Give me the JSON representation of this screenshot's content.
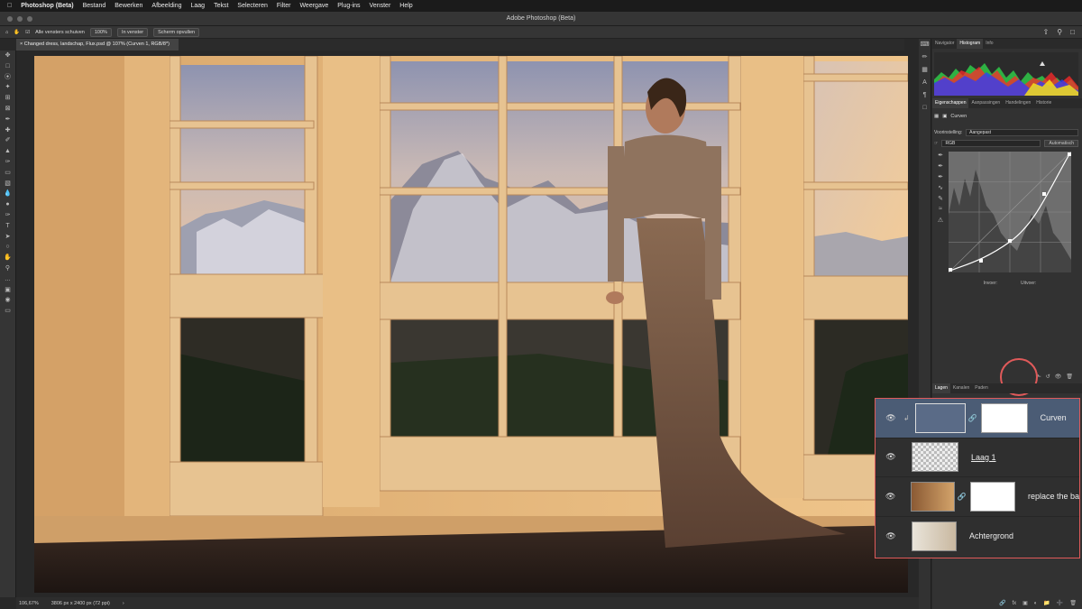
{
  "menubar": {
    "apple": "",
    "app": "Photoshop (Beta)",
    "items": [
      "Bestand",
      "Bewerken",
      "Afbeelding",
      "Laag",
      "Tekst",
      "Selecteren",
      "Filter",
      "Weergave",
      "Plug-ins",
      "Venster",
      "Help"
    ]
  },
  "window": {
    "title": "Adobe Photoshop (Beta)"
  },
  "options": {
    "scroll_all": "Alle vensters schuiven",
    "zoom_100": "100%",
    "fit_screen": "In venster",
    "fill_screen": "Scherm opvullen"
  },
  "document": {
    "tab": "Changed dress, landschap, Flux.psd @ 107% (Curven 1, RGB/8*)"
  },
  "status": {
    "zoom": "106,67%",
    "dimensions": "3806 px x 2400 px (72 ppi)"
  },
  "panels": {
    "top_tabs": [
      "Navigator",
      "Histogram",
      "Info"
    ],
    "top_active": "Histogram",
    "prop_tabs": [
      "Eigenschappen",
      "Aanpassingen",
      "Handelingen",
      "Historie"
    ],
    "prop_active": "Eigenschappen",
    "curves_title": "Curven",
    "preset_label": "Voorinstelling:",
    "preset_value": "Aangepast",
    "channel_value": "RGB",
    "auto_button": "Automatisch",
    "input_label": "Invoer:",
    "output_label": "Uitvoer:",
    "layer_tabs": [
      "Lagen",
      "Kanalen",
      "Paden"
    ],
    "layer_active": "Lagen"
  },
  "layers": [
    {
      "name": "Curven",
      "selected": true
    },
    {
      "name": "Laag 1",
      "selected": false
    },
    {
      "name": "replace the ba",
      "selected": false
    },
    {
      "name": "Achtergrond",
      "selected": false
    }
  ]
}
